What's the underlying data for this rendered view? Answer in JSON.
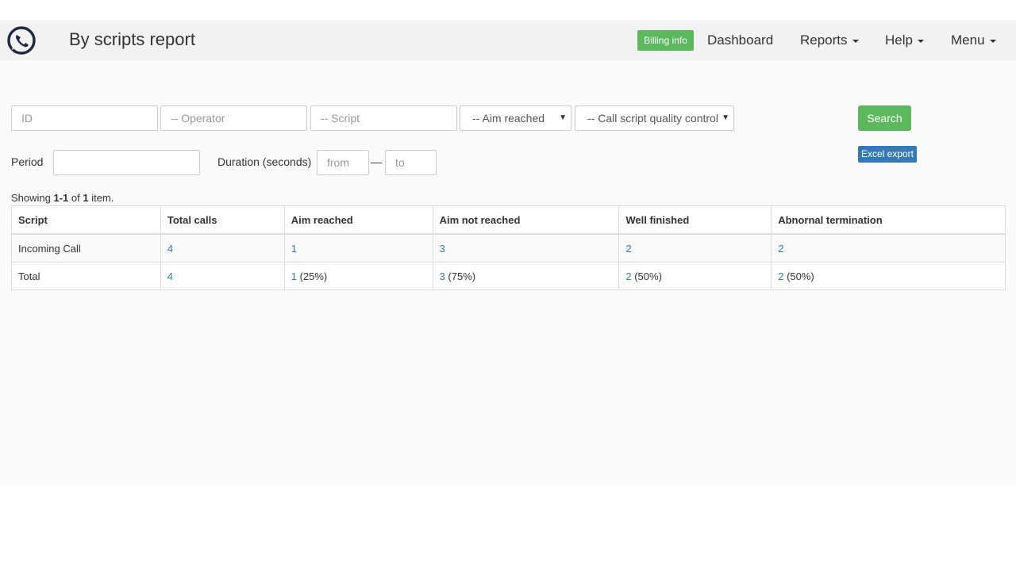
{
  "header": {
    "title": "By scripts report",
    "billing_label": "Billing info",
    "nav": {
      "dashboard": "Dashboard",
      "reports": "Reports",
      "help": "Help",
      "menu": "Menu"
    }
  },
  "filters": {
    "id_placeholder": "ID",
    "operator_placeholder": "-- Operator",
    "script_placeholder": "-- Script",
    "aim_reached": "-- Aim reached",
    "quality_control": "-- Call script quality control",
    "search_label": "Search",
    "excel_label": "Excel export",
    "period_label": "Period",
    "duration_label": "Duration (seconds)",
    "from_placeholder": "from",
    "to_placeholder": "to",
    "range_separator": "—"
  },
  "summary": {
    "prefix": "Showing ",
    "range": "1-1",
    "of": " of ",
    "total": "1",
    "suffix": " item."
  },
  "table": {
    "headers": [
      "Script",
      "Total calls",
      "Aim reached",
      "Aim not reached",
      "Well finished",
      "Abnornal termination"
    ],
    "rows": [
      {
        "script": "Incoming Call",
        "total_calls": "4",
        "aim_reached": "1",
        "aim_reached_pct": "",
        "aim_not_reached": "3",
        "aim_not_reached_pct": "",
        "well_finished": "2",
        "well_finished_pct": "",
        "abnormal": "2",
        "abnormal_pct": ""
      },
      {
        "script": "Total",
        "total_calls": "4",
        "aim_reached": "1",
        "aim_reached_pct": "(25%)",
        "aim_not_reached": "3",
        "aim_not_reached_pct": "(75%)",
        "well_finished": "2",
        "well_finished_pct": "(50%)",
        "abnormal": "2",
        "abnormal_pct": "(50%)"
      }
    ]
  },
  "colors": {
    "success": "#5cb85c",
    "primary": "#337ab7",
    "navbar": "#f2f2f2",
    "logo": "#1f2a44"
  }
}
